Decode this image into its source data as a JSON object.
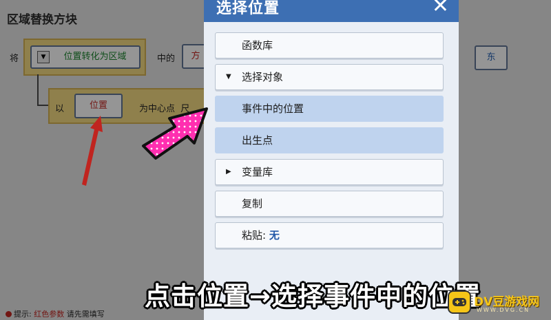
{
  "background": {
    "title": "区域替换方块",
    "row1": {
      "prefix": "将",
      "block_label": "位置转化为区域",
      "middle": "中的",
      "partial_block": "方",
      "right_block": "东"
    },
    "row2": {
      "prefix": "以",
      "position_button": "位置",
      "suffix": "为中心点",
      "suffix_partial": "尺"
    },
    "tip": {
      "prefix": "提示:",
      "highlight": "红色参数",
      "rest": "请先需填写"
    }
  },
  "modal": {
    "title": "选择位置",
    "close_glyph": "✕",
    "items": [
      {
        "label": "函数库",
        "type": "item"
      },
      {
        "label": "选择对象",
        "type": "expanded"
      },
      {
        "label": "事件中的位置",
        "type": "sub"
      },
      {
        "label": "出生点",
        "type": "sub"
      },
      {
        "label": "变量库",
        "type": "collapsed"
      },
      {
        "label": "复制",
        "type": "item"
      },
      {
        "label": "粘贴:",
        "value": "无",
        "type": "item"
      }
    ]
  },
  "caption": "点击位置→选择事件中的位置",
  "watermark": {
    "text": "DV豆游戏网",
    "sub": "WWW.DVG.CN"
  },
  "colors": {
    "modal_header": "#3d6fb3",
    "submenu_bg": "#bfd3ee",
    "pointer_arrow": "#ff2fb0",
    "red_arrow": "#b8231f"
  }
}
